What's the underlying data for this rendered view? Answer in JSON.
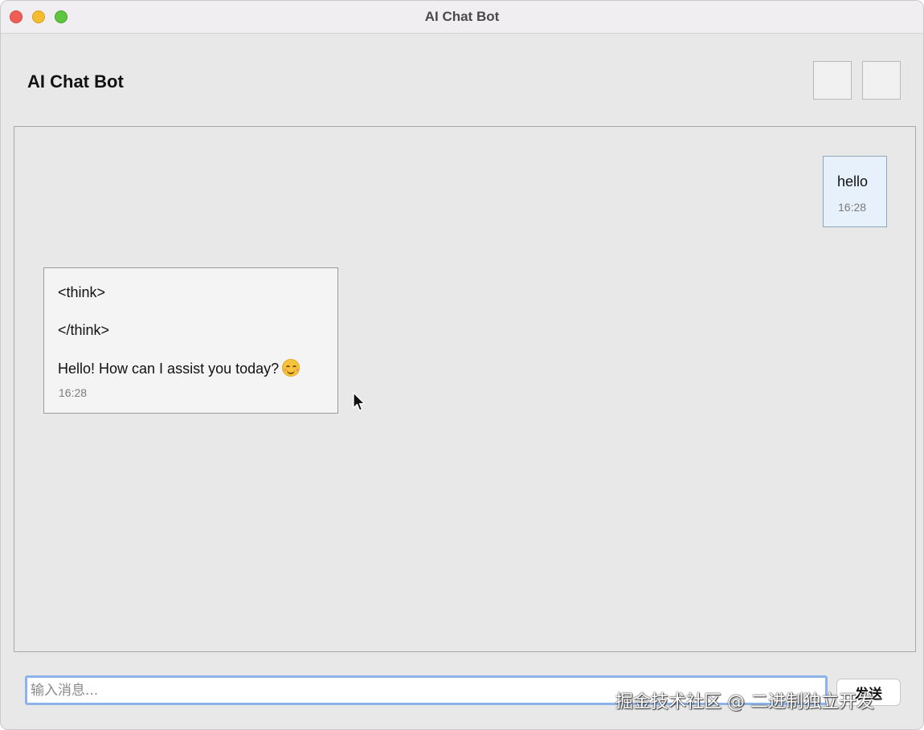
{
  "window": {
    "title": "AI Chat Bot"
  },
  "header": {
    "title": "AI Chat Bot",
    "buttons": [
      {
        "name": "header-button-1",
        "label": ""
      },
      {
        "name": "header-button-2",
        "label": ""
      }
    ]
  },
  "messages": [
    {
      "role": "user",
      "lines": [
        "hello"
      ],
      "time": "16:28"
    },
    {
      "role": "bot",
      "lines": [
        "<think>",
        "</think>",
        "Hello! How can I assist you today?"
      ],
      "emoji": "smiling-face-emoji",
      "time": "16:28"
    }
  ],
  "input": {
    "value": "",
    "placeholder": "输入消息..."
  },
  "send_button": {
    "label": "发送"
  },
  "watermark": {
    "text": "掘金技术社区 @ 二进制独立开发"
  },
  "colors": {
    "user_bubble": "#e6f1fb",
    "bot_bubble": "#f4f4f4",
    "input_focus_border": "#8db3ea"
  },
  "icons": {
    "cursor": "mouse-pointer-icon",
    "close": "close-window-icon",
    "minimize": "minimize-window-icon",
    "maximize": "maximize-window-icon"
  }
}
